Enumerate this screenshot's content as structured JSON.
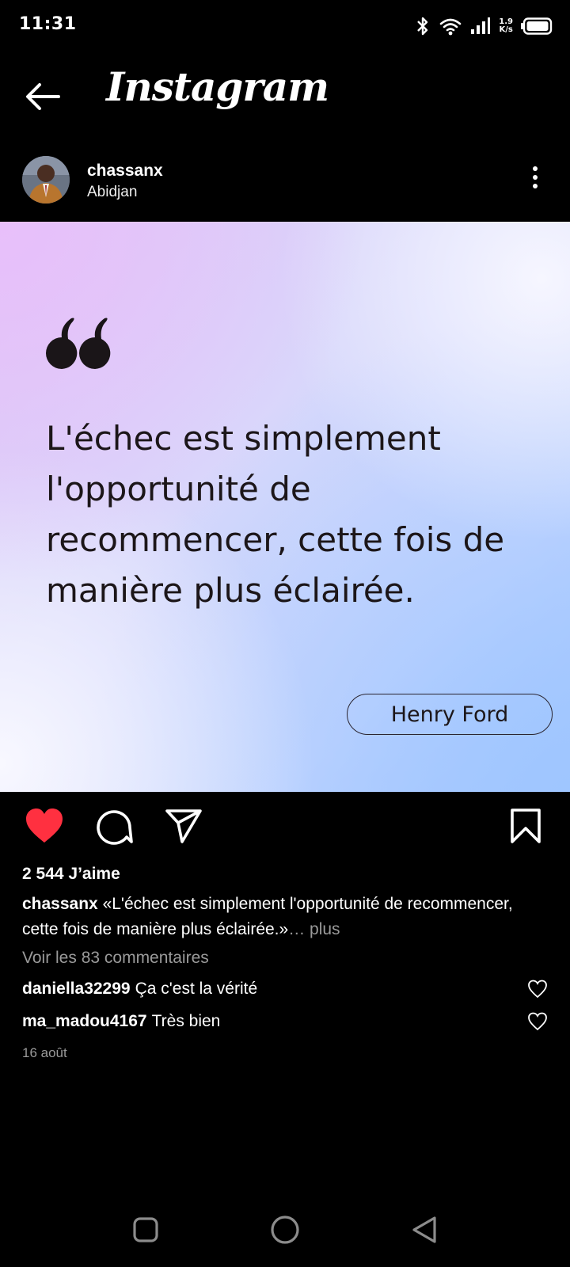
{
  "status_bar": {
    "time": "11:31",
    "speed_value": "1.9",
    "speed_unit": "K/s",
    "icons": [
      "bluetooth-icon",
      "wifi-icon",
      "signal-icon",
      "battery-icon"
    ]
  },
  "app_bar": {
    "back_icon": "arrow-left-icon",
    "title": "Instagram"
  },
  "post": {
    "username": "chassanx",
    "location": "Abidjan",
    "image": {
      "quote": "L'échec est simplement l'opportunité de recommencer, cette fois de manière plus éclairée.",
      "author": "Henry Ford"
    },
    "liked": true,
    "like_color": "#ff3040",
    "likes": "2 544 J’aime",
    "caption_user": "chassanx",
    "caption_text": "«L'échec est simplement l'opportunité de recommencer, cette fois de manière plus éclairée.»",
    "caption_more": "… plus",
    "view_comments": "Voir les 83 commentaires",
    "comments": [
      {
        "user": "daniella32299",
        "text": "Ça c'est la vérité"
      },
      {
        "user": "ma_madou4167",
        "text": "Très bien"
      }
    ],
    "date": "16 août"
  },
  "nav_bar": {
    "icons": [
      "recent-apps-icon",
      "home-icon",
      "back-triangle-icon"
    ]
  }
}
